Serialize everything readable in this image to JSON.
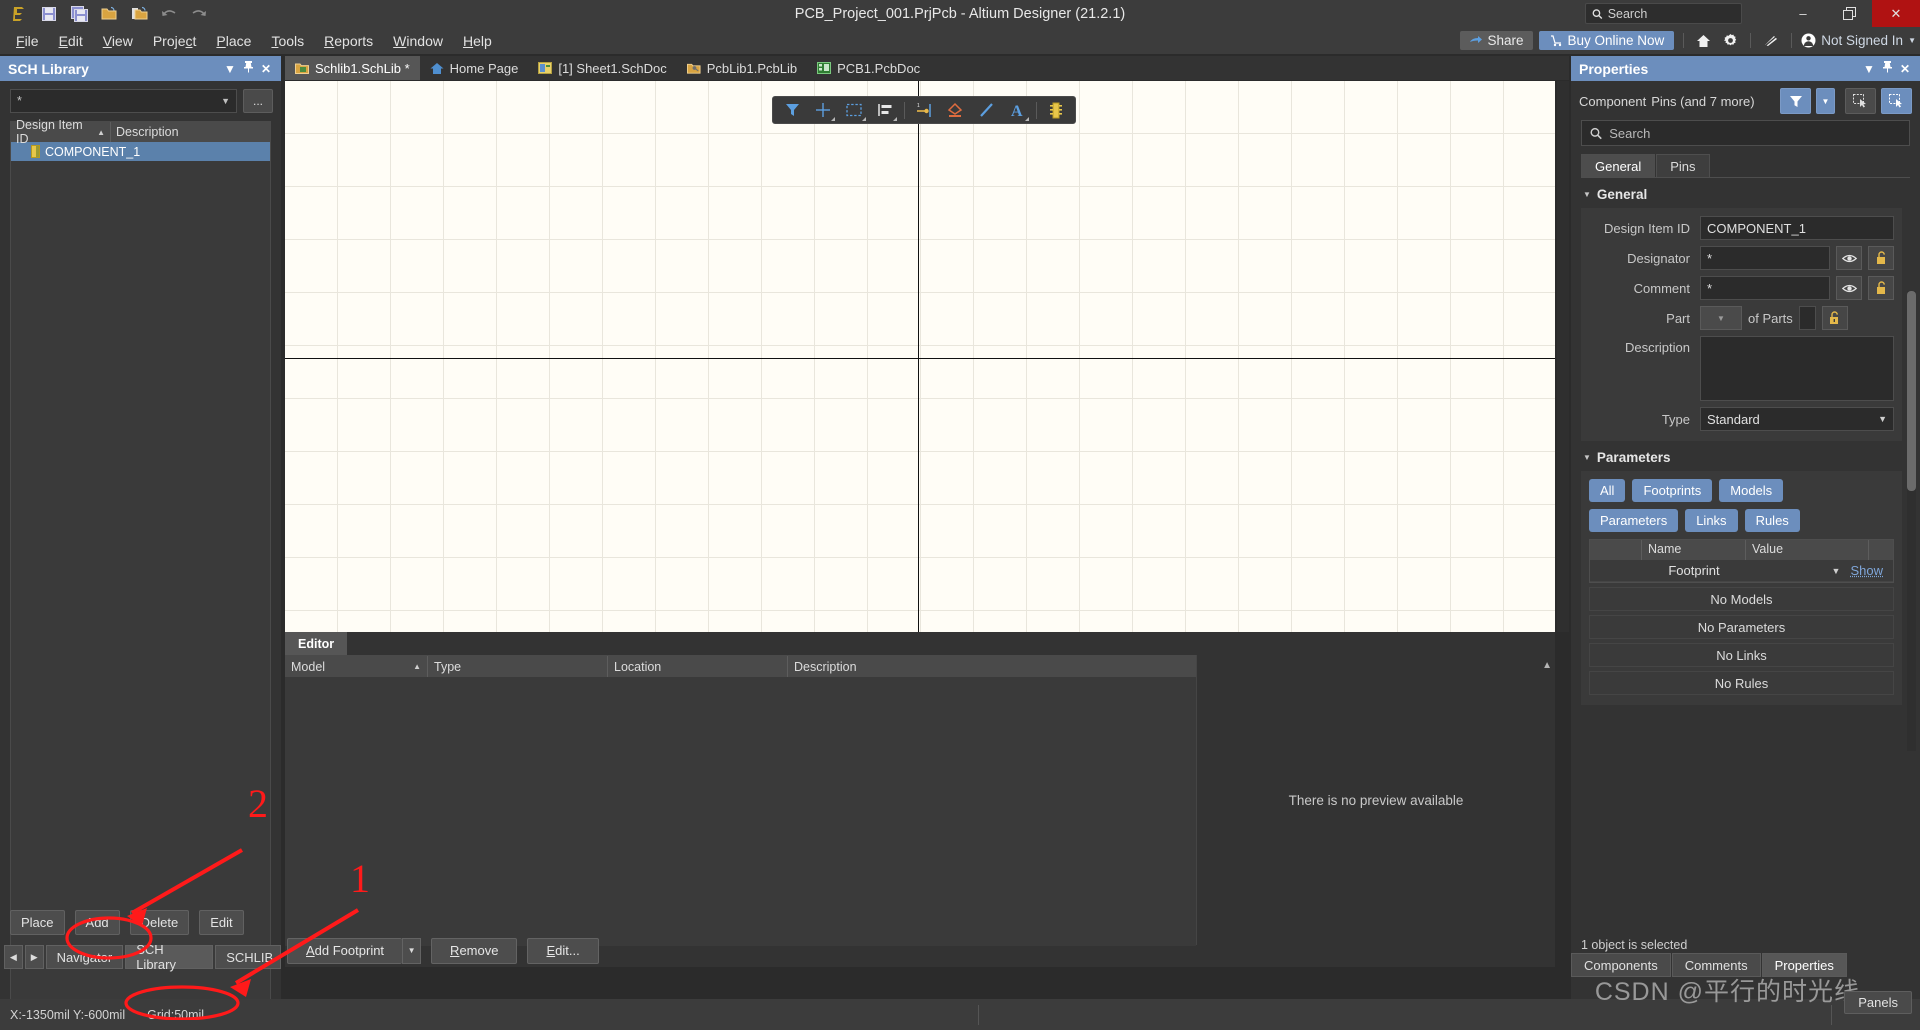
{
  "titlebar": {
    "title": "PCB_Project_001.PrjPcb - Altium Designer (21.2.1)",
    "search_placeholder": "Search",
    "quick_icons": [
      "altium-logo-icon",
      "save-icon",
      "save-all-icon",
      "open-icon",
      "open-project-icon",
      "undo-icon",
      "redo-icon"
    ],
    "minimize": "–",
    "restore": "❐",
    "close": "✕"
  },
  "menubar": {
    "items": [
      "File",
      "Edit",
      "View",
      "Project",
      "Place",
      "Tools",
      "Reports",
      "Window",
      "Help"
    ],
    "share_label": "Share",
    "buy_label": "Buy Online Now",
    "account_label": "Not Signed In"
  },
  "left_panel": {
    "title": "SCH Library",
    "filter_value": "*",
    "dots_label": "...",
    "columns": [
      "Design Item ID",
      "Description"
    ],
    "rows": [
      {
        "design_item_id": "COMPONENT_1",
        "description": ""
      }
    ],
    "buttons": [
      "Place",
      "Add",
      "Delete",
      "Edit"
    ],
    "tabs": [
      "Navigator",
      "SCH Library",
      "SCHLIB"
    ],
    "active_tab": "SCH Library"
  },
  "document_tabs": {
    "tabs": [
      {
        "label": "Schlib1.SchLib *",
        "icon": "schlib-icon",
        "active": true
      },
      {
        "label": "Home Page",
        "icon": "home-icon",
        "active": false
      },
      {
        "label": "[1] Sheet1.SchDoc",
        "icon": "schdoc-icon",
        "active": false
      },
      {
        "label": "PcbLib1.PcbLib",
        "icon": "pcblib-icon",
        "active": false
      },
      {
        "label": "PCB1.PcbDoc",
        "icon": "pcbdoc-icon",
        "active": false
      }
    ]
  },
  "canvas_toolbar": {
    "items": [
      "filter-icon",
      "crosshair-icon",
      "rectangle-select-icon",
      "align-icon",
      "place-pin-icon",
      "place-polygon-icon",
      "place-line-icon",
      "place-text-icon",
      "place-component-icon"
    ]
  },
  "editor_pane": {
    "tab_label": "Editor",
    "model_columns": [
      "Model",
      "Type",
      "Location",
      "Description"
    ],
    "model_rows": [],
    "preview_text": "There is no preview available",
    "buttons": {
      "add_footprint": "Add Footprint",
      "remove": "Remove",
      "edit": "Edit..."
    }
  },
  "properties": {
    "title": "Properties",
    "object_label": "Component",
    "object_count_label": "Pins (and 7 more)",
    "search_placeholder": "Search",
    "tabs": [
      "General",
      "Pins"
    ],
    "active_tab": "General",
    "general": {
      "heading": "General",
      "design_item_id_label": "Design Item ID",
      "design_item_id_value": "COMPONENT_1",
      "designator_label": "Designator",
      "designator_value": "*",
      "comment_label": "Comment",
      "comment_value": "*",
      "part_label": "Part",
      "of_parts_label": "of Parts",
      "description_label": "Description",
      "description_value": "",
      "type_label": "Type",
      "type_value": "Standard"
    },
    "parameters": {
      "heading": "Parameters",
      "pills": [
        "All",
        "Footprints",
        "Models",
        "Parameters",
        "Links",
        "Rules"
      ],
      "columns": [
        "Name",
        "Value"
      ],
      "rows": [
        {
          "name": "Footprint",
          "value": "",
          "action": "Show"
        }
      ],
      "empty_states": [
        "No Models",
        "No Parameters",
        "No Links",
        "No Rules"
      ]
    },
    "status": "1 object is selected",
    "bottom_tabs": [
      "Components",
      "Comments",
      "Properties"
    ],
    "active_bottom_tab": "Properties"
  },
  "statusbar": {
    "coords": "X:-1350mil Y:-600mil",
    "grid": "Grid:50mil",
    "panels_button": "Panels"
  },
  "annotations": {
    "marker_1": "1",
    "marker_2": "2",
    "color": "#ff1a1a"
  },
  "watermark": "CSDN @平行的时光线"
}
